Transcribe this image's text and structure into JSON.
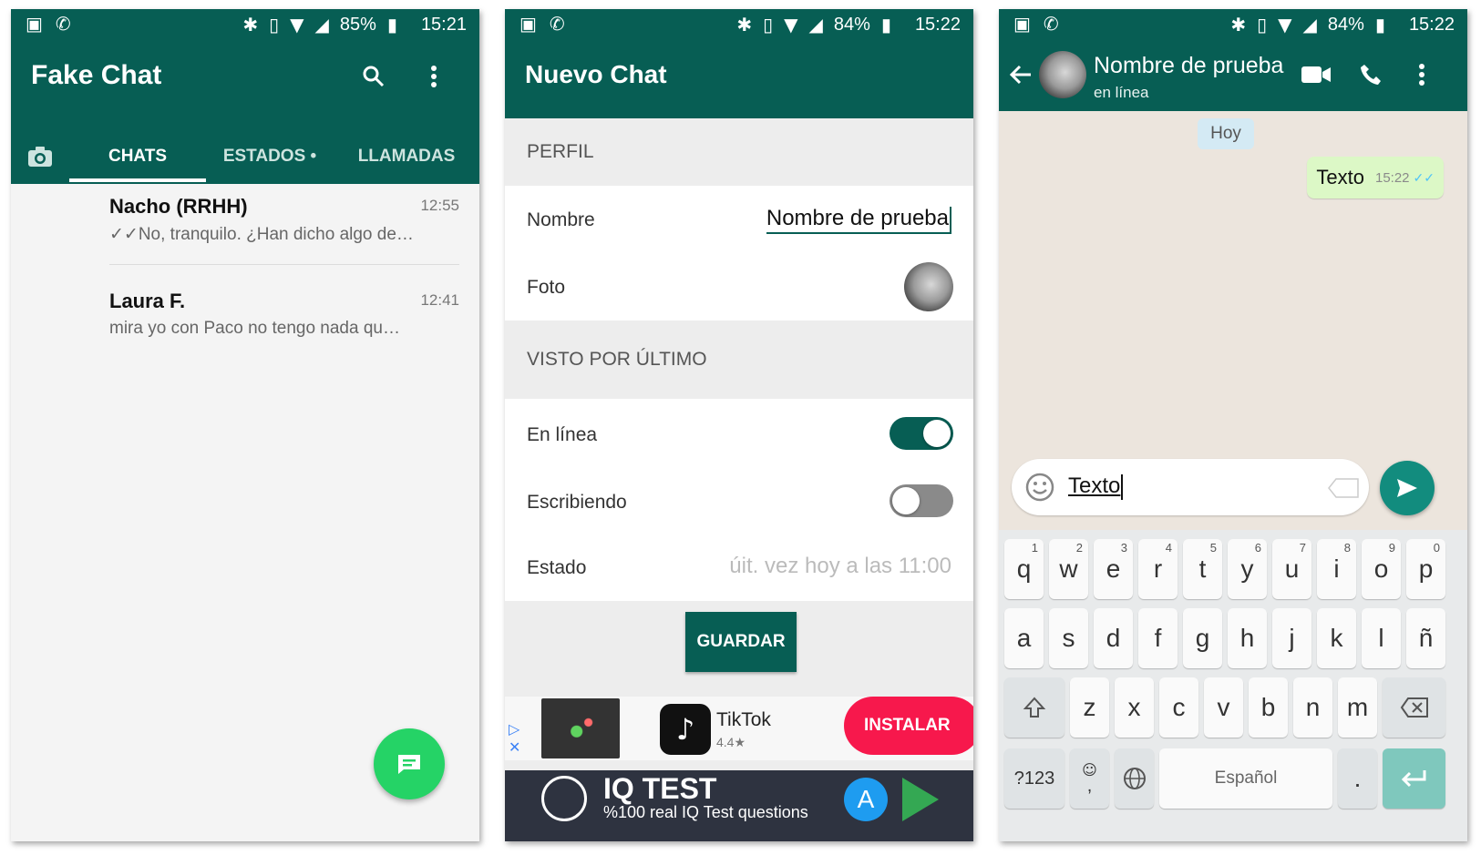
{
  "phones": {
    "p1": {
      "status": {
        "battery": "85%",
        "time": "15:21"
      },
      "title": "Fake Chat",
      "tabs": [
        "CHATS",
        "ESTADOS •",
        "LLAMADAS"
      ],
      "chats": [
        {
          "name": "Nacho (RRHH)",
          "time": "12:55",
          "message": "✓✓No, tranquilo. ¿Han dicho algo de…"
        },
        {
          "name": "Laura F.",
          "time": "12:41",
          "message": "mira yo con Paco no tengo nada qu…"
        }
      ]
    },
    "p2": {
      "status": {
        "battery": "84%",
        "time": "15:22"
      },
      "title": "Nuevo Chat",
      "section_profile": "PERFIL",
      "name_label": "Nombre",
      "name_value": "Nombre de prueba",
      "photo_label": "Foto",
      "section_lastseen": "VISTO POR ÚLTIMO",
      "online_label": "En línea",
      "online_on": true,
      "typing_label": "Escribiendo",
      "typing_on": false,
      "status_label": "Estado",
      "status_placeholder": "úit. vez hoy a las 11:00",
      "save_label": "GUARDAR",
      "ad": {
        "app_name": "TikTok",
        "rating": "4.4★",
        "install_label": "INSTALAR",
        "banner_title": "IQ TEST",
        "banner_sub": "%100 real IQ Test questions"
      }
    },
    "p3": {
      "status": {
        "battery": "84%",
        "time": "15:22"
      },
      "contact_name": "Nombre de prueba",
      "contact_status": "en línea",
      "date_chip": "Hoy",
      "message_text": "Texto",
      "message_time": "15:22",
      "input_value": "Texto",
      "keyboard": {
        "row1": [
          [
            "q",
            "1"
          ],
          [
            "w",
            "2"
          ],
          [
            "e",
            "3"
          ],
          [
            "r",
            "4"
          ],
          [
            "t",
            "5"
          ],
          [
            "y",
            "6"
          ],
          [
            "u",
            "7"
          ],
          [
            "i",
            "8"
          ],
          [
            "o",
            "9"
          ],
          [
            "p",
            "0"
          ]
        ],
        "row2": [
          "a",
          "s",
          "d",
          "f",
          "g",
          "h",
          "j",
          "k",
          "l",
          "ñ"
        ],
        "row3": [
          "z",
          "x",
          "c",
          "v",
          "b",
          "n",
          "m"
        ],
        "sym_label": "?123",
        "emoji_comma": ",",
        "space_label": "Español",
        "period": "."
      }
    }
  },
  "colors": {
    "primary": "#075e54",
    "accent": "#25d366",
    "bubble": "#dcf8c6",
    "ad_install": "#f7184c"
  }
}
